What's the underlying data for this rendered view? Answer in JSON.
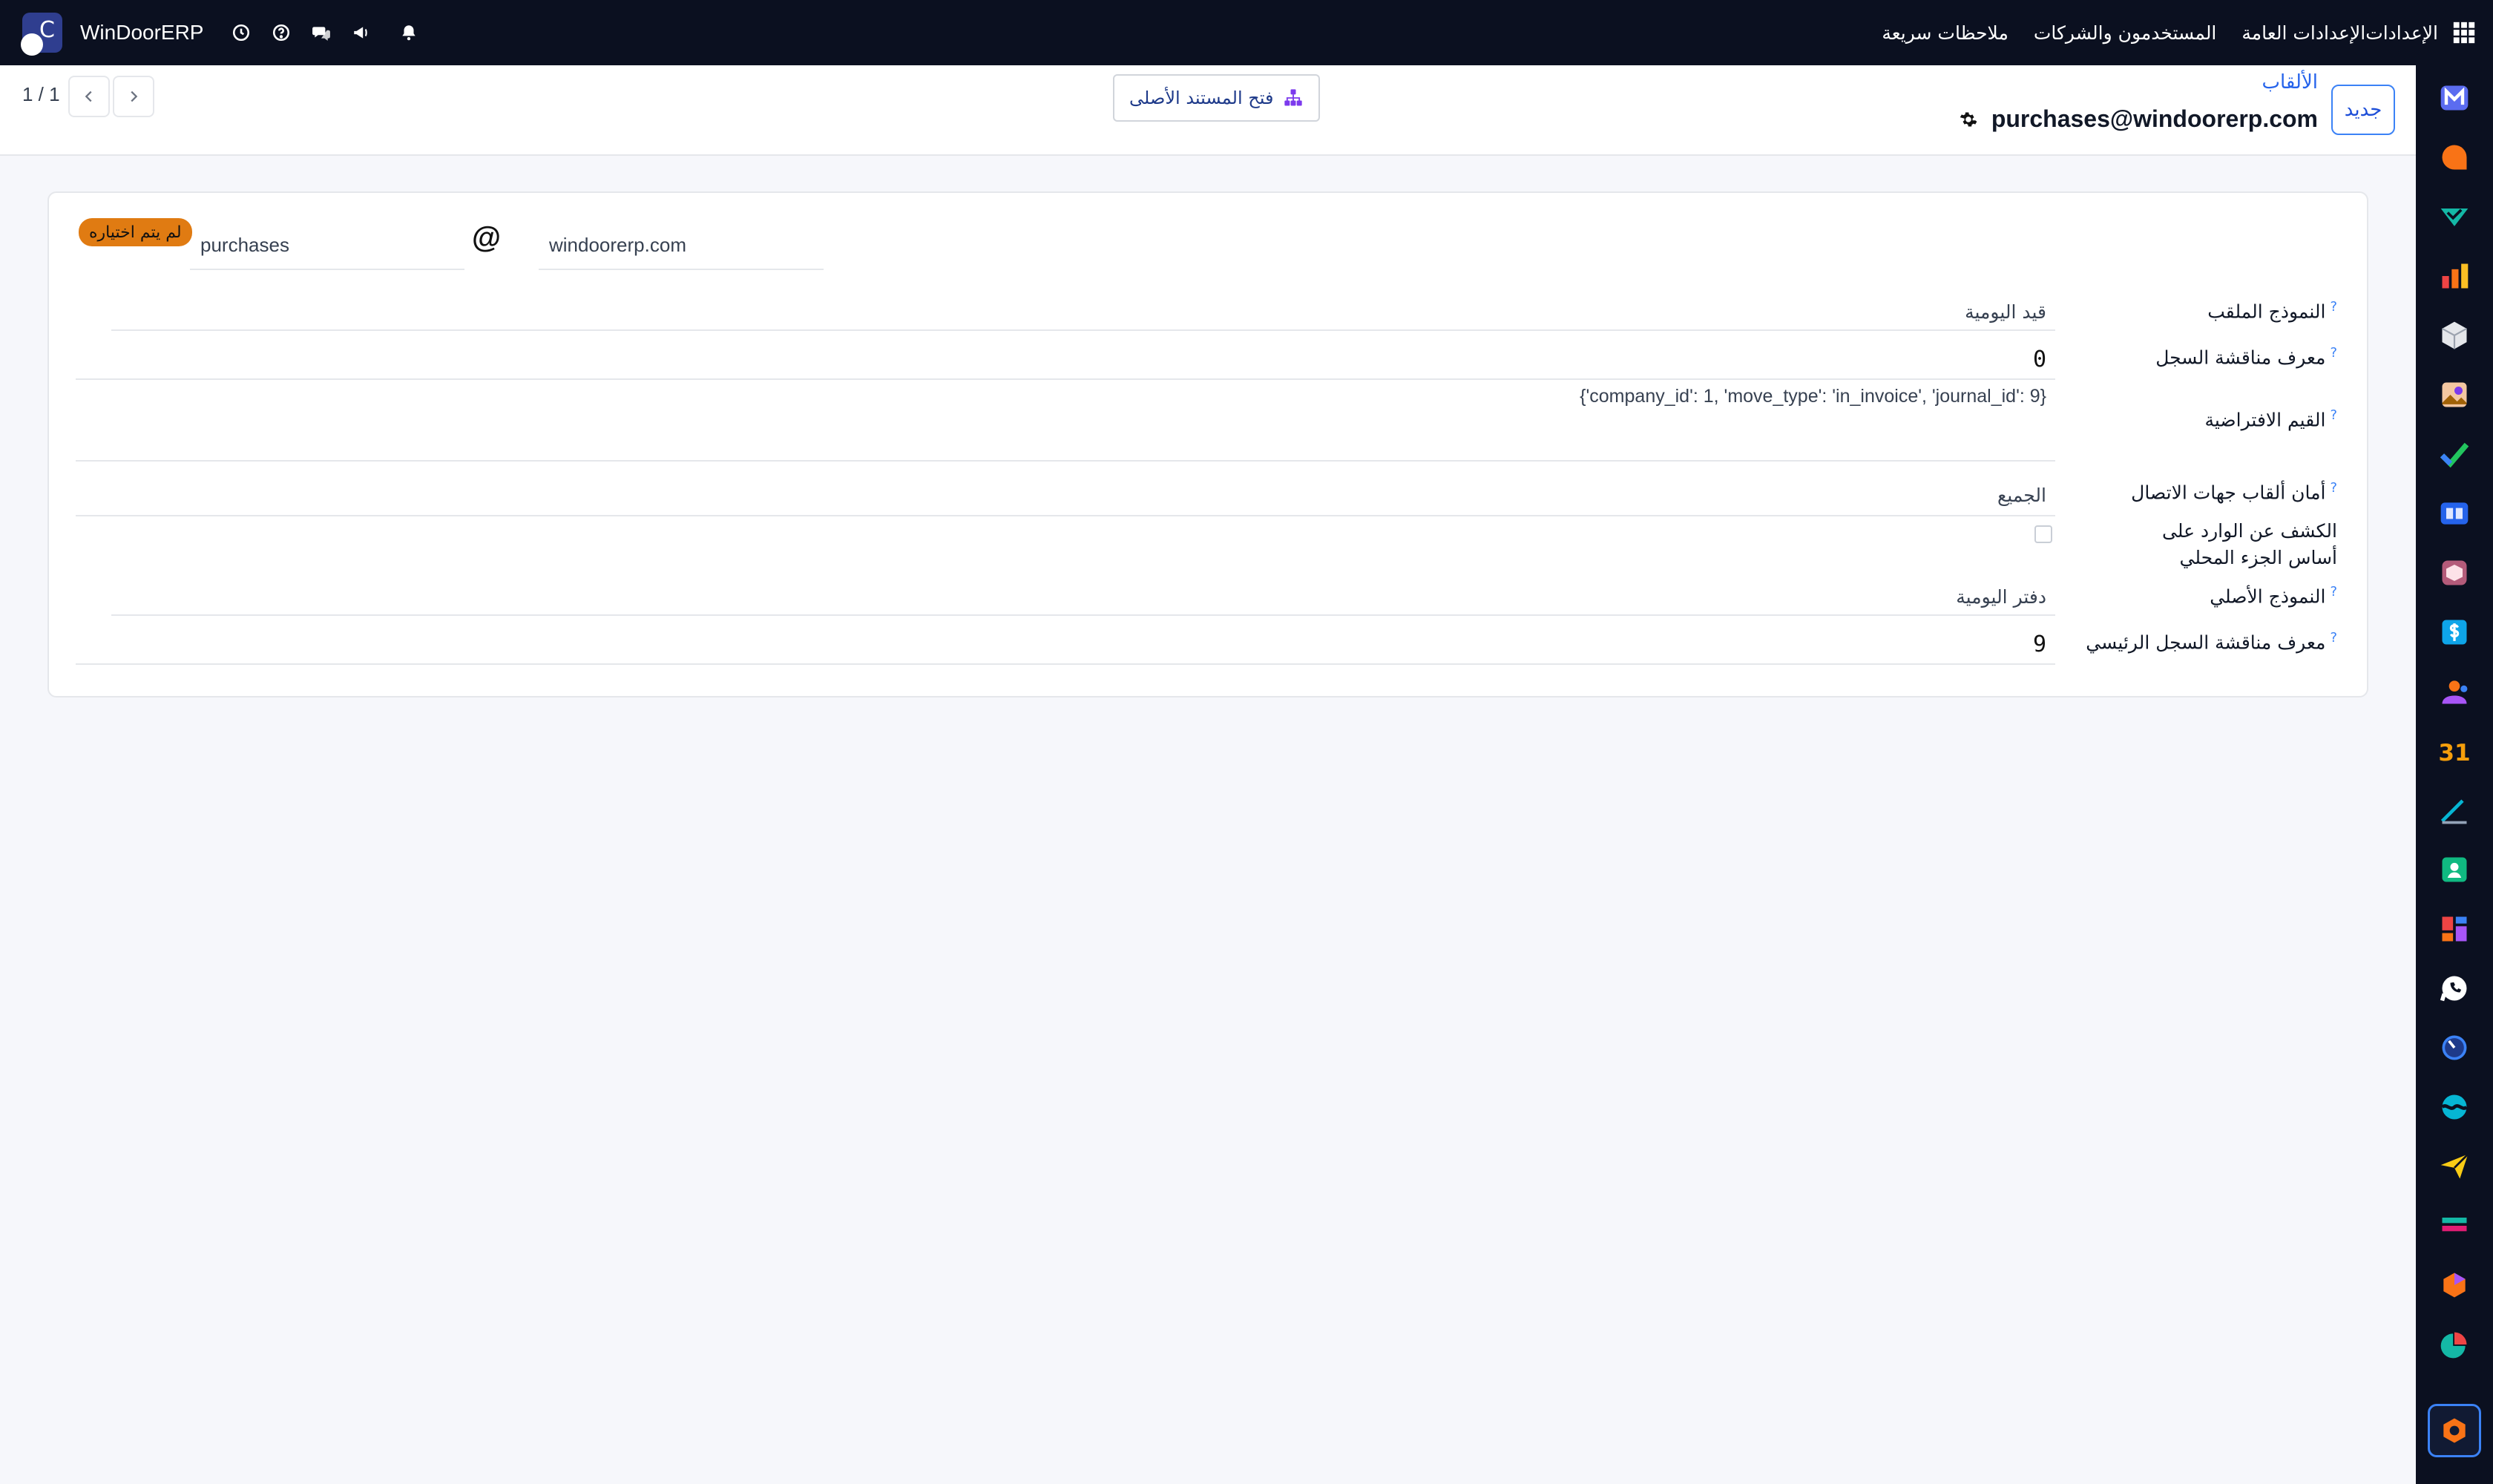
{
  "topbar": {
    "brand": "WinDoorERP",
    "menu": [
      "الإعدادات",
      "الإعدادات العامة",
      "المستخدمون والشركات",
      "ملاحظات سريعة"
    ]
  },
  "control_panel": {
    "pager": "1 / 1",
    "open_parent_label": "فتح المستند الأصلى",
    "new_label": "جديد",
    "breadcrumb_parent": "الألقاب",
    "breadcrumb_current": "purchases@windoorerp.com"
  },
  "form": {
    "status_badge": "لم يتم اختياره",
    "alias_name": "purchases",
    "alias_domain": "windoorerp.com",
    "at": "@",
    "fields": [
      {
        "label": "النموذج الملقب",
        "value": "قيد اليومية",
        "help": "?"
      },
      {
        "label": "معرف مناقشة السجل",
        "value": "0",
        "help": "?"
      },
      {
        "label": "القيم الافتراضية",
        "value": "{'company_id': 1, 'move_type': 'in_invoice', 'journal_id': 9}",
        "help": "?"
      },
      {
        "label": "أمان ألقاب جهات الاتصال",
        "value": "الجميع",
        "help": "?"
      },
      {
        "label": "الكشف عن الوارد على أساس الجزء المحلي",
        "value": "",
        "checked": false
      },
      {
        "label": "النموذج الأصلي",
        "value": "دفتر اليومية",
        "help": "?"
      },
      {
        "label": "معرف مناقشة السجل الرئيسي",
        "value": "9",
        "help": "?"
      }
    ]
  },
  "rail_icons": [
    "mail-icon",
    "discuss-icon",
    "check-icon",
    "chart-icon",
    "box-icon",
    "image-icon",
    "task-icon",
    "book-icon",
    "package-icon",
    "dollar-icon",
    "people-icon",
    "calendar-icon",
    "sign-icon",
    "contacts-icon",
    "dashboard-icon",
    "whatsapp-icon",
    "timer-icon",
    "wave-icon",
    "send-icon",
    "layers-icon",
    "cube-icon",
    "pie-icon",
    "settings-app-icon"
  ],
  "rail_calendar_label": "31"
}
